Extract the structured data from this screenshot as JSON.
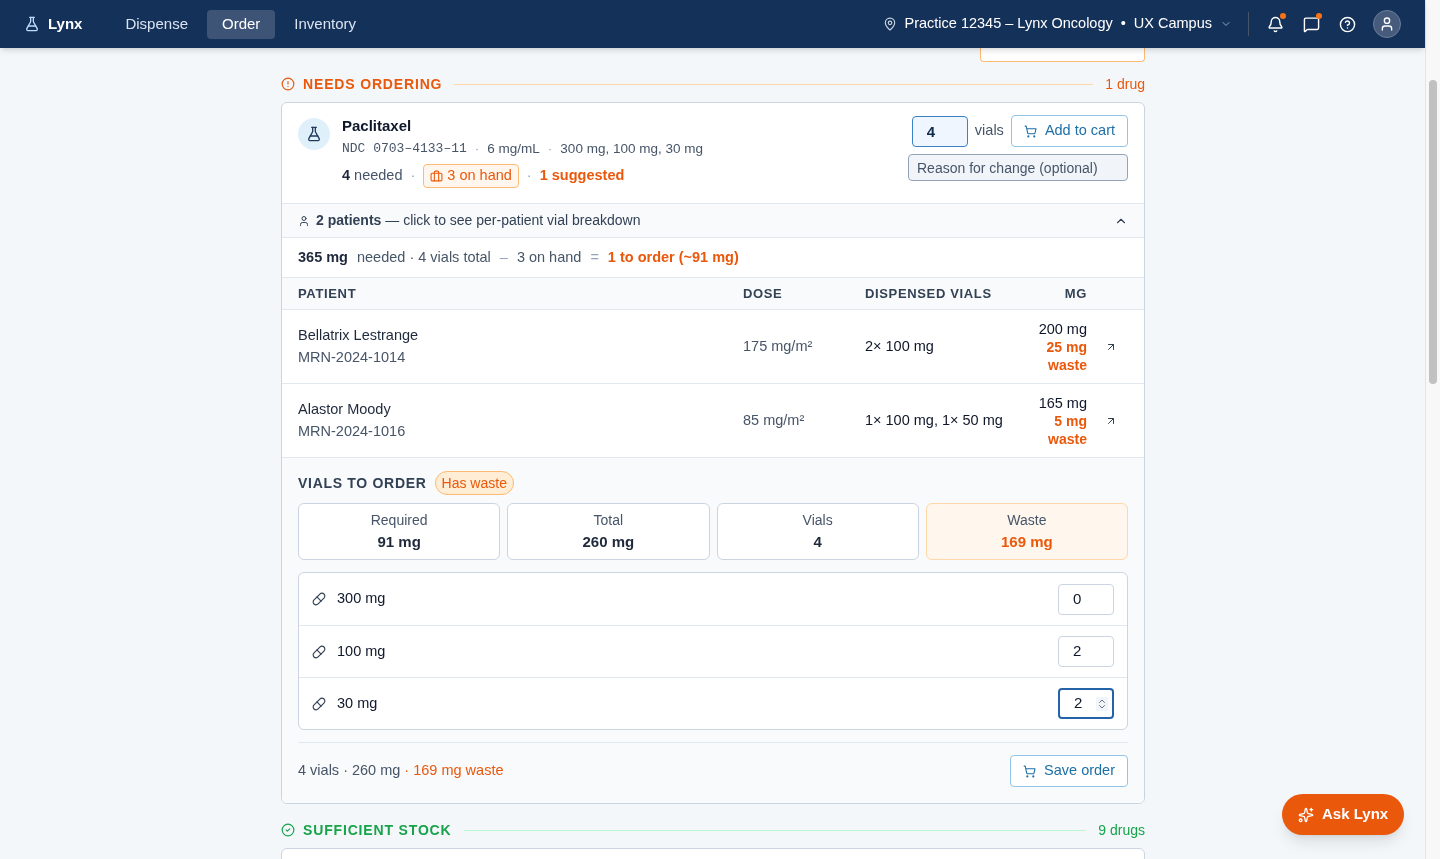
{
  "nav": {
    "brand": "Lynx",
    "tabs": [
      {
        "label": "Dispense",
        "selected": false
      },
      {
        "label": "Order",
        "selected": true
      },
      {
        "label": "Inventory",
        "selected": false
      }
    ],
    "location": "Practice 12345 – Lynx Oncology",
    "separator": "•",
    "campus": "UX Campus",
    "alerts": [
      {
        "kind": "bell",
        "unread": true
      },
      {
        "kind": "chat",
        "unread": true
      },
      {
        "kind": "help",
        "unread": false
      }
    ]
  },
  "dot": "·",
  "needs_ordering": {
    "title": "NEEDS ORDERING",
    "count": "1 drug",
    "drug": {
      "name": "Paclitaxel",
      "ndc": "NDC 0703–4133–11",
      "concentration": "6 mg/mL",
      "sizes": "300 mg, 100 mg, 30 mg",
      "needed_count": "4",
      "needed_label": "needed",
      "on_hand": "3 on hand",
      "suggested": "1 suggested",
      "quantity": "4",
      "quantity_unit": "vials",
      "add_to_cart": "Add to cart",
      "reason_placeholder": "Reason for change (optional)"
    },
    "breakdown": {
      "text": "**2 patients** — click to see per-patient vial breakdown",
      "expanded": true
    },
    "summary": {
      "total": "365 mg",
      "rest": "needed · 4 vials total",
      "minus": "–",
      "on_hand": "3 on hand",
      "equals": "=",
      "to_order": "1 to order (~91 mg)"
    },
    "table": {
      "columns": [
        "PATIENT",
        "DOSE",
        "DISPENSED VIALS",
        "MG"
      ],
      "rows": [
        {
          "name": "Bellatrix Lestrange",
          "mrn": "MRN-2024-1014",
          "dose": "175 mg/m²",
          "vials": "2× 100 mg",
          "mg": "200 mg",
          "waste": "25 mg waste"
        },
        {
          "name": "Alastor Moody",
          "mrn": "MRN-2024-1016",
          "dose": "85 mg/m²",
          "vials": "1× 100 mg, 1× 50 mg",
          "mg": "165 mg",
          "waste": "5 mg waste"
        }
      ]
    },
    "vials_to_order": {
      "title": "VIALS TO ORDER",
      "badge": "Has waste",
      "stats": [
        {
          "label": "Required",
          "value": "91 mg",
          "kind": "plain"
        },
        {
          "label": "Total",
          "value": "260 mg",
          "kind": "plain"
        },
        {
          "label": "Vials",
          "value": "4",
          "kind": "plain"
        },
        {
          "label": "Waste",
          "value": "169 mg",
          "kind": "warning"
        }
      ],
      "sizes": [
        {
          "label": "300 mg",
          "value": "0",
          "focused": false
        },
        {
          "label": "100 mg",
          "value": "2",
          "focused": false
        },
        {
          "label": "30 mg",
          "value": "2",
          "focused": true
        }
      ],
      "footer": {
        "summary": "4 vials · 260 mg",
        "waste": "· 169 mg waste",
        "save": "Save order"
      }
    }
  },
  "sufficient_stock": {
    "title": "SUFFICIENT STOCK",
    "count": "9 drugs"
  },
  "assistant": {
    "label": "Ask Lynx"
  }
}
